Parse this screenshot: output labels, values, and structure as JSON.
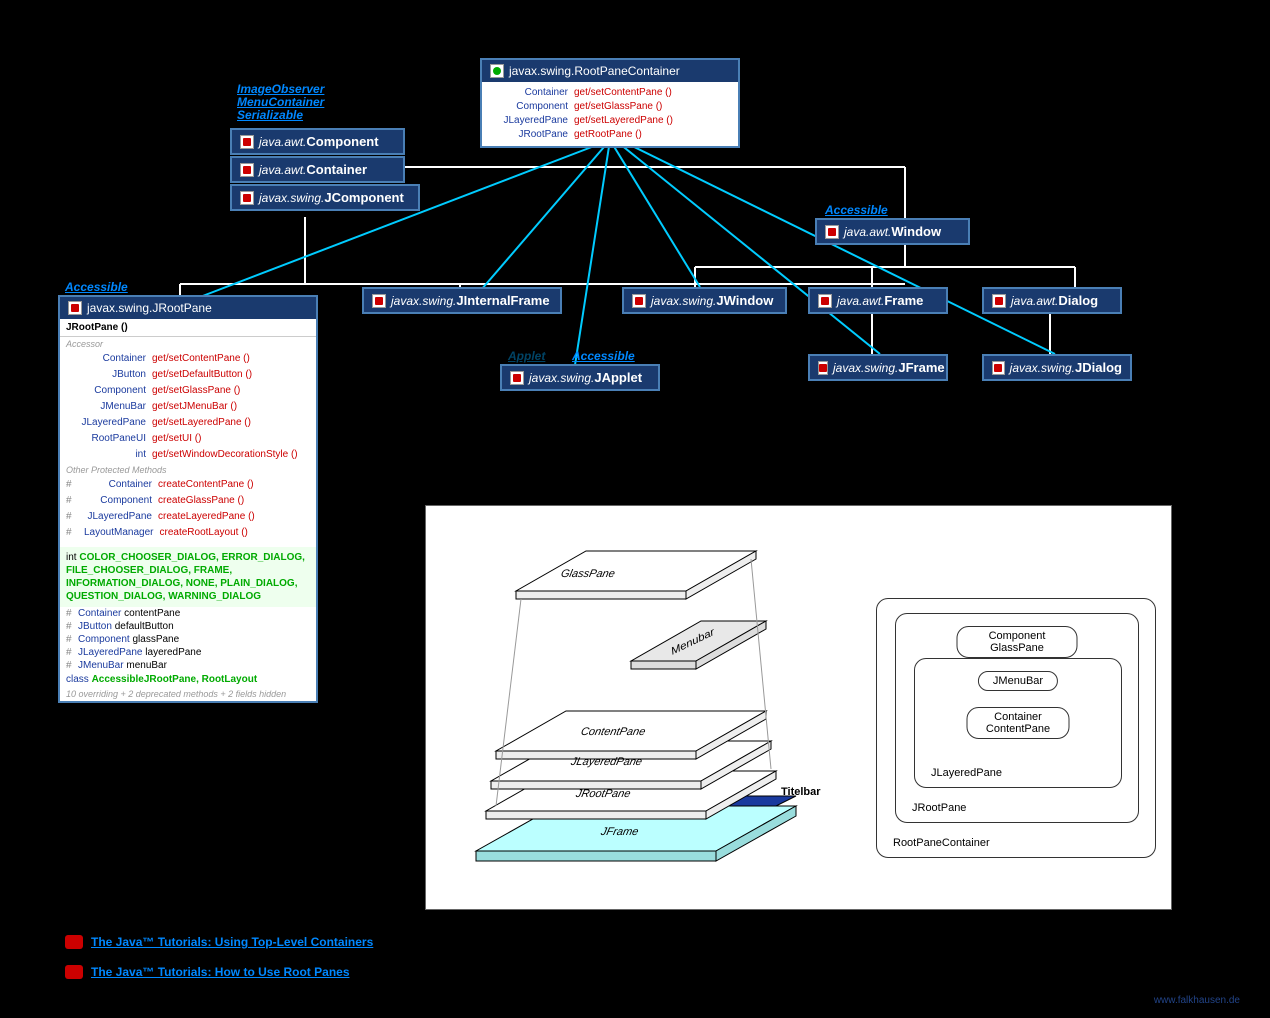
{
  "rootPaneContainer": {
    "pkg": "javax.swing.",
    "name": "RootPaneContainer",
    "methods": [
      {
        "ret": "Container",
        "name": "get/setContentPane ()"
      },
      {
        "ret": "Component",
        "name": "get/setGlassPane ()"
      },
      {
        "ret": "JLayeredPane",
        "name": "get/setLayeredPane ()"
      },
      {
        "ret": "JRootPane",
        "name": "getRootPane ()"
      }
    ]
  },
  "componentStack": {
    "interfaces": "ImageObserver\nMenuContainer\nSerializable",
    "items": [
      {
        "pkg": "java.awt.",
        "name": "Component"
      },
      {
        "pkg": "java.awt.",
        "name": "Container"
      },
      {
        "pkg": "javax.swing.",
        "name": "JComponent"
      }
    ]
  },
  "window": {
    "pkg": "java.awt.",
    "name": "Window",
    "stereotype": "Accessible"
  },
  "jrootpane": {
    "stereotype": "Accessible",
    "pkg": "javax.swing.",
    "name": "JRootPane",
    "constructor": "JRootPane ()",
    "accessorLabel": "Accessor",
    "accessors": [
      {
        "ret": "Container",
        "name": "get/setContentPane ()"
      },
      {
        "ret": "JButton",
        "name": "get/setDefaultButton ()"
      },
      {
        "ret": "Component",
        "name": "get/setGlassPane ()"
      },
      {
        "ret": "JMenuBar",
        "name": "get/setJMenuBar ()"
      },
      {
        "ret": "JLayeredPane",
        "name": "get/setLayeredPane ()"
      },
      {
        "ret": "RootPaneUI",
        "name": "get/setUI ()"
      },
      {
        "ret": "int",
        "name": "get/setWindowDecorationStyle ()"
      }
    ],
    "otherLabel": "Other Protected Methods",
    "protecteds": [
      {
        "ret": "Container",
        "name": "createContentPane ()"
      },
      {
        "ret": "Component",
        "name": "createGlassPane ()"
      },
      {
        "ret": "JLayeredPane",
        "name": "createLayeredPane ()"
      },
      {
        "ret": "LayoutManager",
        "name": "createRootLayout ()"
      }
    ],
    "constantsType": "int",
    "constants": "COLOR_CHOOSER_DIALOG, ERROR_DIALOG, FILE_CHOOSER_DIALOG, FRAME, INFORMATION_DIALOG, NONE, PLAIN_DIALOG, QUESTION_DIALOG, WARNING_DIALOG",
    "fields": [
      {
        "type": "Container",
        "name": "contentPane"
      },
      {
        "type": "JButton",
        "name": "defaultButton"
      },
      {
        "type": "Component",
        "name": "glassPane"
      },
      {
        "type": "JLayeredPane",
        "name": "layeredPane"
      },
      {
        "type": "JMenuBar",
        "name": "menuBar"
      }
    ],
    "innerPrefix": "class",
    "innerNames": "AccessibleJRootPane, RootLayout",
    "summary": "10 overriding + 2 deprecated methods + 2 fields hidden"
  },
  "classes": {
    "jinternalframe": {
      "pkg": "javax.swing.",
      "name": "JInternalFrame"
    },
    "japplet": {
      "pkg": "javax.swing.",
      "name": "JApplet",
      "stereo1": "Applet",
      "stereo2": "Accessible"
    },
    "jwindow": {
      "pkg": "javax.swing.",
      "name": "JWindow"
    },
    "frame": {
      "pkg": "java.awt.",
      "name": "Frame"
    },
    "dialog": {
      "pkg": "java.awt.",
      "name": "Dialog"
    },
    "jframe": {
      "pkg": "javax.swing.",
      "name": "JFrame"
    },
    "jdialog": {
      "pkg": "javax.swing.",
      "name": "JDialog"
    }
  },
  "illustration3d": {
    "glassPane": "GlassPane",
    "menubar": "Menubar",
    "contentPane": "ContentPane",
    "jlayeredPane": "JLayeredPane",
    "jrootPane": "JRootPane",
    "jframe": "JFrame",
    "titelbar": "Titelbar"
  },
  "nested": {
    "rootPaneContainer": "RootPaneContainer",
    "jrootPane": "JRootPane",
    "jlayeredPane": "JLayeredPane",
    "glassPane": "Component GlassPane",
    "jmenuBar": "JMenuBar",
    "contentPane": "Container ContentPane"
  },
  "links": {
    "link1": "The Java™ Tutorials: Using Top-Level Containers",
    "link2": "The Java™ Tutorials: How to Use Root Panes"
  },
  "footer": "www.falkhausen.de"
}
